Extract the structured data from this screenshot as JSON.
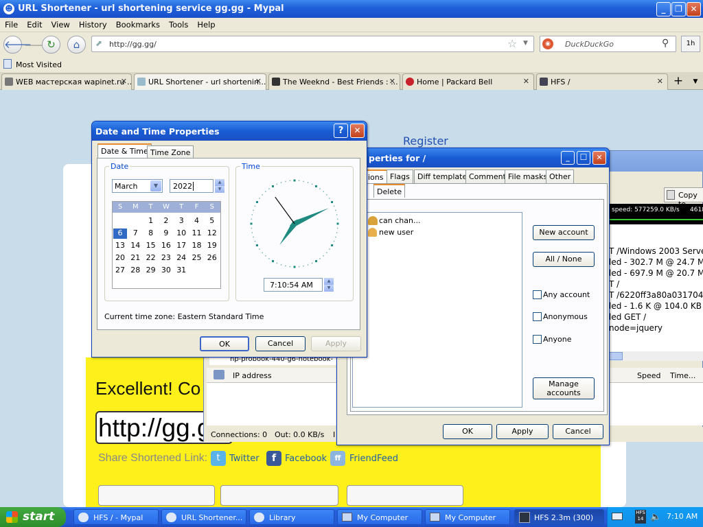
{
  "browser": {
    "title": "URL Shortener - url shortening service gg.gg - Mypal",
    "menu": [
      "File",
      "Edit",
      "View",
      "History",
      "Bookmarks",
      "Tools",
      "Help"
    ],
    "url": "http://gg.gg/",
    "search_placeholder": "DuckDuckGo",
    "bookmark": "Most Visited",
    "tabs": [
      {
        "label": "WEB мастерская wapinet.ru ..."
      },
      {
        "label": "URL Shortener - url shortenin..."
      },
      {
        "label": "The Weeknd - Best Friends : ..."
      },
      {
        "label": "Home | Packard Bell"
      },
      {
        "label": "HFS /"
      }
    ]
  },
  "page": {
    "register": "Register",
    "excellent": "Excellent! Co",
    "short_url": "http://gg.g",
    "share_label": "Share Shortened Link:",
    "share": [
      "Twitter",
      "Facebook",
      "FriendFeed"
    ]
  },
  "datetime": {
    "title": "Date and Time Properties",
    "tabs": [
      "Date & Time",
      "Time Zone"
    ],
    "date_label": "Date",
    "time_label": "Time",
    "month": "March",
    "year": "2022",
    "weekdays": [
      "S",
      "M",
      "T",
      "W",
      "T",
      "F",
      "S"
    ],
    "days": [
      [
        "",
        "",
        "1",
        "2",
        "3",
        "4",
        "5"
      ],
      [
        "6",
        "7",
        "8",
        "9",
        "10",
        "11",
        "12"
      ],
      [
        "13",
        "14",
        "15",
        "16",
        "17",
        "18",
        "19"
      ],
      [
        "20",
        "21",
        "22",
        "23",
        "24",
        "25",
        "26"
      ],
      [
        "27",
        "28",
        "29",
        "30",
        "31",
        "",
        ""
      ]
    ],
    "selected_day": "6",
    "time": "7:10:54 AM",
    "timezone": "Current time zone:  Eastern Standard Time",
    "buttons": {
      "ok": "OK",
      "cancel": "Cancel",
      "apply": "Apply"
    }
  },
  "props": {
    "title": "perties for /",
    "tabs": [
      "ions",
      "Flags",
      "Diff template",
      "Comment",
      "File masks",
      "Other"
    ],
    "subtabs": [
      "Delete"
    ],
    "users": [
      "can chan...",
      "new user"
    ],
    "new_account": "New account",
    "all_none": "All / None",
    "checks": [
      "Any account",
      "Anonymous",
      "Anyone"
    ],
    "manage": "Manage accounts",
    "buttons": {
      "ok": "OK",
      "apply": "Apply",
      "cancel": "Cancel"
    }
  },
  "hfs": {
    "copy_to": "Copy to",
    "speed_text": "speed: 577259.0 KB/s",
    "speed_right": "4618",
    "log": [
      "T /Windows 2003 Serve",
      "led - 302.7 M @ 24.7 M",
      "led - 697.9 M @ 20.7 M",
      "T /",
      "T /6220ff3a80a0317047",
      "led - 1.6 K @ 104.0 KB",
      "led GET /",
      "node=jquery"
    ],
    "file_row": "hp-probook-440-g6-notebook-",
    "ip_header": "IP address",
    "speed_header": "Speed",
    "time_header": "Time...",
    "status": {
      "connections": "Connections: 0",
      "out": "Out: 0.0 KB/s",
      "in": "I"
    }
  },
  "taskbar": {
    "start": "start",
    "items": [
      "HFS / - Mypal",
      "URL Shortener...",
      "Library",
      "My Computer",
      "My Computer",
      "HFS 2.3m (300)"
    ],
    "clock": "7:10 AM",
    "tray_badge": "HFS 14"
  }
}
